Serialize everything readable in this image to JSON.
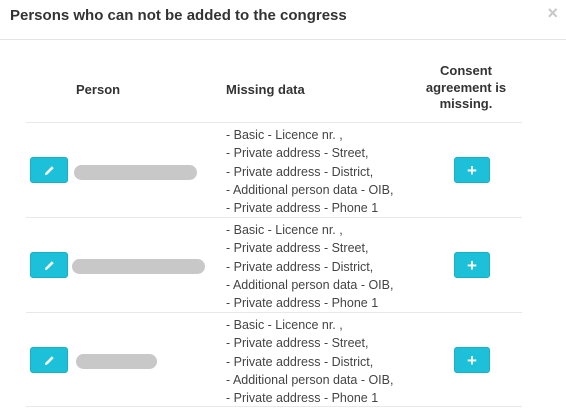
{
  "dialog": {
    "title": "Persons who can not be added to the congress",
    "close_glyph": "×"
  },
  "table": {
    "headers": {
      "person": "Person",
      "missing_data": "Missing data",
      "consent": [
        "Consent",
        "agreement is",
        "missing."
      ]
    },
    "rows": [
      {
        "missing": [
          "- Basic - Licence nr. ,",
          "- Private address - Street,",
          "- Private address - District,",
          "- Additional person data - OIB,",
          "- Private address - Phone 1"
        ]
      },
      {
        "missing": [
          "- Basic - Licence nr. ,",
          "- Private address - Street,",
          "- Private address - District,",
          "- Additional person data - OIB,",
          "- Private address - Phone 1"
        ]
      },
      {
        "missing": [
          "- Basic - Licence nr. ,",
          "- Private address - Street,",
          "- Private address - District,",
          "- Additional person data - OIB,",
          "- Private address - Phone 1"
        ]
      }
    ]
  },
  "icons": {
    "edit": "pencil-icon",
    "add": "plus-icon"
  },
  "colors": {
    "button": "#1cc1d9",
    "redacted_name": "#c8c8c8",
    "close": "#c8c8c8"
  },
  "buttons": {
    "add_glyph": "+"
  }
}
